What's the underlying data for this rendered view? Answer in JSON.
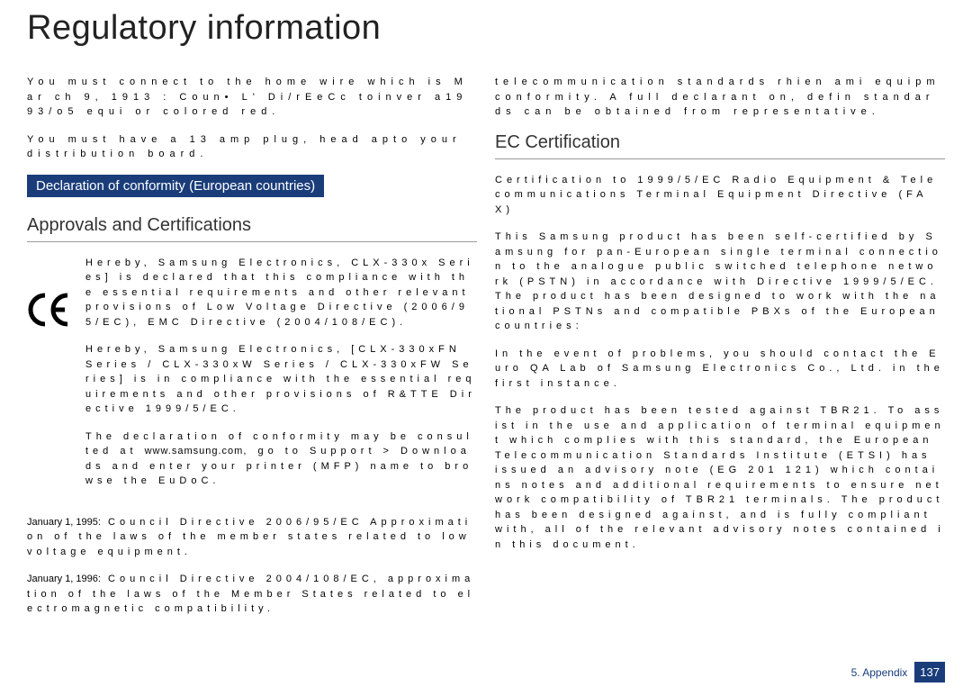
{
  "title": "Regulatory information",
  "top_left_p1": "You must connect to the home wire which is Mar ch 9, 1913 : Coun• L' Di/rEeCc toinver a1993/o5 equi or colored red.",
  "top_left_p2": "You must have a 13 amp plug, head apto your distribution board.",
  "top_right_p1": "telecommunication standards rhien ami equipm conformity. A full declarant on, defin standards can be obtained from representative.",
  "blue_header": "Declaration of conformity (European countries)",
  "approvals_heading": "Approvals and Certifications",
  "ce_p1": "Hereby, Samsung Electronics, CLX-330x Series] is declared that this compliance with the essential requirements and other relevant provisions of Low Voltage Directive (2006/95/EC), EMC Directive (2004/108/EC).",
  "ce_p2": "Hereby, Samsung Electronics, [CLX-330xFN Series / CLX-330xW Series / CLX-330xFW Series] is in compliance with the essential requirements and other provisions of R&TTE Directive 1999/5/EC.",
  "ce_p3_a": "The declaration of conformity may be consulted at ",
  "ce_p3_link": "www.samsung.com",
  "ce_p3_b": ", go to Support > Downloads and enter your printer (MFP) name to browse the EuDoC.",
  "date1_prefix": "January 1, 1995:",
  "date1_text": " Council Directive 2006/95/EC Approximation of the laws of the member states related to low voltage equipment.",
  "date2_prefix": "January 1, 1996:",
  "date2_text": " Council Directive 2004/108/EC, approximation of the laws of the Member States related to electromagnetic compatibility.",
  "ec_heading": "EC Certification",
  "ec_p1": "Certification to 1999/5/EC Radio Equipment & Telecommunications Terminal Equipment Directive (FAX)",
  "ec_p2": "This Samsung product has been self-certified by Samsung for pan-European single terminal connection to the analogue public switched telephone network (PSTN) in accordance with Directive 1999/5/EC. The product has been designed to work with the national PSTNs and compatible PBXs of the European countries:",
  "ec_p3": "In the event of problems, you should contact the Euro QA Lab of Samsung Electronics Co., Ltd. in the first instance.",
  "ec_p4": "The product has been tested against TBR21. To assist in the use and application of terminal equipment which complies with this standard, the European Telecommunication Standards Institute (ETSI) has issued an advisory note (EG 201 121) which contains notes and additional requirements to ensure network compatibility of TBR21 terminals. The product has been designed against, and is fully compliant with, all of the relevant advisory notes contained in this document.",
  "footer_label": "5. Appendix",
  "footer_page": "137"
}
